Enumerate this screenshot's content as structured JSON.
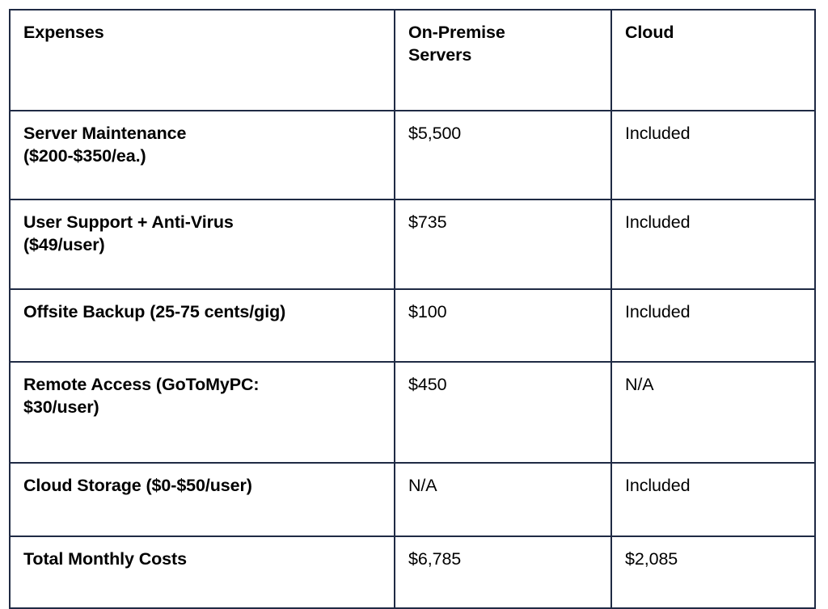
{
  "table": {
    "columns": [
      {
        "key": "expenses",
        "label": "Expenses"
      },
      {
        "key": "on_premise",
        "label": "On-Premise\nServers"
      },
      {
        "key": "cloud",
        "label": "Cloud"
      }
    ],
    "header": {
      "col0": "Expenses",
      "col1_line1": "On-Premise",
      "col1_line2": "Servers",
      "col2": "Cloud"
    },
    "rows": [
      {
        "expense_line1": "Server Maintenance",
        "expense_line2": "($200-$350/ea.)",
        "on_premise": "$5,500",
        "cloud": "Included"
      },
      {
        "expense_line1": "User Support + Anti-Virus",
        "expense_line2": "($49/user)",
        "on_premise": "$735",
        "cloud": "Included"
      },
      {
        "expense_line1": "Offsite Backup (25-75 cents/gig)",
        "expense_line2": "",
        "on_premise": "$100",
        "cloud": "Included"
      },
      {
        "expense_line1": "Remote Access (GoToMyPC:",
        "expense_line2": "$30/user)",
        "on_premise": "$450",
        "cloud": "N/A"
      },
      {
        "expense_line1": "Cloud Storage ($0-$50/user)",
        "expense_line2": "",
        "on_premise": "N/A",
        "cloud": "Included"
      },
      {
        "expense_line1": "Total Monthly Costs",
        "expense_line2": "",
        "on_premise": "$6,785",
        "cloud": "$2,085"
      }
    ]
  },
  "style": {
    "border_color": "#1f2a44",
    "text_color": "#000000",
    "background": "#ffffff"
  }
}
